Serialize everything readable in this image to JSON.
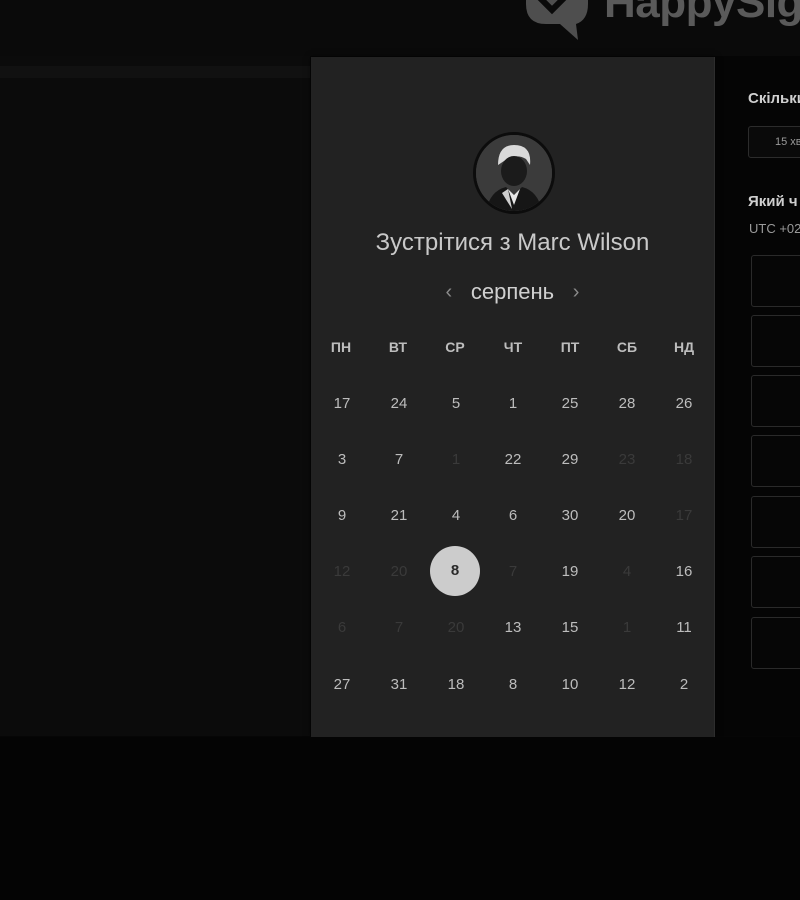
{
  "header": {
    "logo_text": "HappySig"
  },
  "card": {
    "title": "Зустрітися з Marc Wilson",
    "month": "серпень",
    "prev_arrow": "‹",
    "next_arrow": "›",
    "weekdays": [
      "ПН",
      "ВТ",
      "СР",
      "ЧТ",
      "ПТ",
      "СБ",
      "НД"
    ],
    "weeks": [
      [
        "17",
        "24",
        "5",
        "1",
        "25",
        "28",
        "26"
      ],
      [
        "3",
        "7",
        "1",
        "22",
        "29",
        "23",
        "18"
      ],
      [
        "9",
        "21",
        "4",
        "6",
        "30",
        "20",
        "17"
      ],
      [
        "12",
        "20",
        "8",
        "7",
        "19",
        "4",
        "16"
      ],
      [
        "6",
        "7",
        "20",
        "13",
        "15",
        "1",
        "11"
      ],
      [
        "27",
        "31",
        "18",
        "8",
        "10",
        "12",
        "2"
      ]
    ],
    "selected_day": "8"
  },
  "sidebar": {
    "duration_heading": "Скільки",
    "duration_value": "15 хв",
    "time_heading": "Який ч",
    "timezone": "UTC +02"
  },
  "colors": {
    "background": "#060606",
    "card": "#222222",
    "selected": "#cccccc",
    "text": "#bdbdbd",
    "disabled_text": "#3a3a3a"
  }
}
